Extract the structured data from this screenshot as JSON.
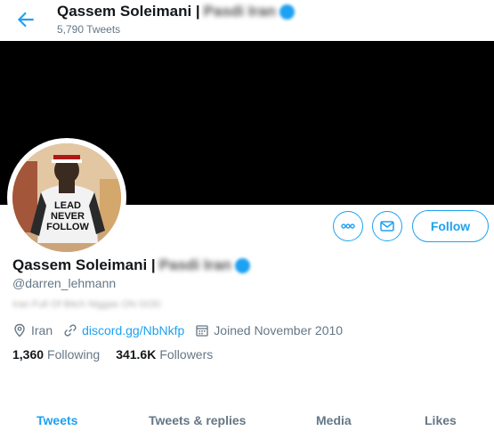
{
  "header": {
    "name": "Qassem Soleimani |",
    "name_suffix_blurred": "Pasdi Iran",
    "tweet_count": "5,790 Tweets"
  },
  "profile": {
    "display_name": "Qassem Soleimani |",
    "display_name_suffix_blurred": "Pasdi Iran",
    "handle": "@darren_lehmann",
    "bio_blurred": "Iran Full Of Bitch Niggas ON GOD",
    "location": "Iran",
    "website": "discord.gg/NbNkfp",
    "joined": "Joined November 2010",
    "following_count": "1,360",
    "following_label": "Following",
    "followers_count": "341.6K",
    "followers_label": "Followers",
    "avatar_shirt_text": [
      "LEAD",
      "NEVER",
      "FOLLOW"
    ]
  },
  "actions": {
    "follow_label": "Follow",
    "more_icon": "more-icon",
    "message_icon": "mail-icon"
  },
  "tabs": [
    {
      "label": "Tweets",
      "active": true
    },
    {
      "label": "Tweets & replies",
      "active": false
    },
    {
      "label": "Media",
      "active": false
    },
    {
      "label": "Likes",
      "active": false
    }
  ],
  "colors": {
    "accent": "#1da1f2",
    "banner": "#000000",
    "secondary_text": "#657786"
  }
}
